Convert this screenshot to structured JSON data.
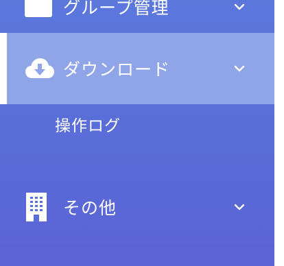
{
  "sidebar": {
    "items": [
      {
        "label": "グループ管理",
        "icon": "group-icon"
      },
      {
        "label": "ダウンロード",
        "icon": "cloud-download-icon"
      },
      {
        "label": "その他",
        "icon": "building-icon"
      }
    ],
    "sub_items": [
      {
        "label": "操作ログ"
      }
    ]
  },
  "colors": {
    "sidebar_bg": "#5a6fd9",
    "active_bg": "#8fa5e8",
    "active_indicator": "#ffffff",
    "text": "#ffffff"
  }
}
